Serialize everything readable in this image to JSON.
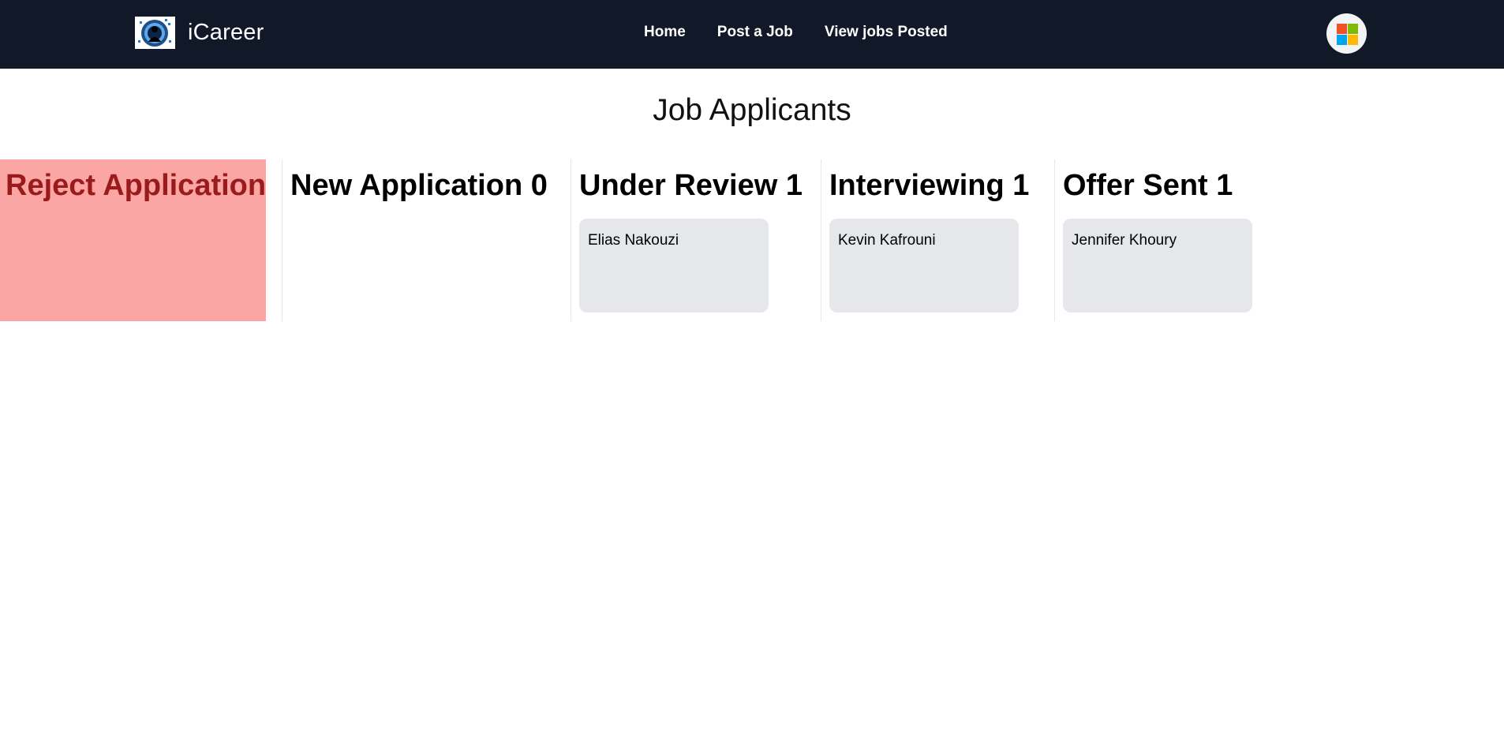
{
  "navbar": {
    "brand_name": "iCareer",
    "links": [
      "Home",
      "Post a Job",
      "View jobs Posted"
    ],
    "background": "#111827",
    "account_icon": "microsoft-logo-icon"
  },
  "main": {
    "title": "Job Applicants",
    "reject_zone": {
      "label": "Reject Application",
      "background": "#fca5a5",
      "text_color": "#991b1b"
    },
    "columns": [
      {
        "title": "New Application 0",
        "cards": []
      },
      {
        "title": "Under Review 1",
        "cards": [
          "Elias Nakouzi"
        ]
      },
      {
        "title": "Interviewing 1",
        "cards": [
          "Kevin Kafrouni"
        ]
      },
      {
        "title": "Offer Sent 1",
        "cards": [
          "Jennifer Khoury"
        ]
      }
    ],
    "card_color": "#e5e7eb"
  }
}
